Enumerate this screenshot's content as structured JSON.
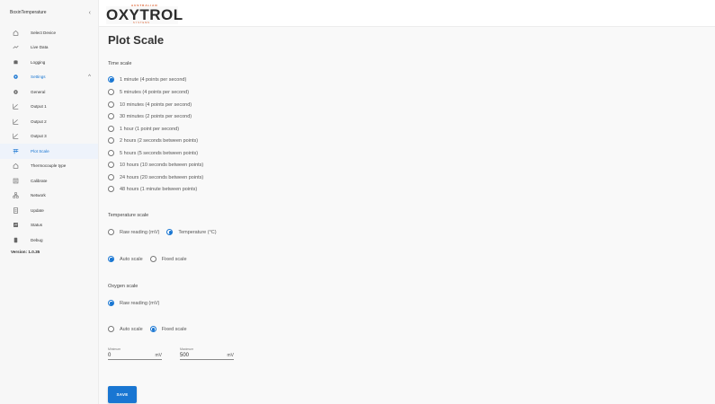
{
  "sidebar": {
    "title": "BoxinTemperature",
    "collapse_icon": "chevron-left-icon",
    "items": [
      {
        "label": "Select Device",
        "icon": "home-icon"
      },
      {
        "label": "Live Data",
        "icon": "trend-icon"
      },
      {
        "label": "Logging",
        "icon": "database-icon"
      },
      {
        "label": "Settings",
        "icon": "gear-icon"
      },
      {
        "label": "General",
        "icon": "gear-icon"
      },
      {
        "label": "Output 1",
        "icon": "chart-line-icon"
      },
      {
        "label": "Output 2",
        "icon": "chart-line-icon"
      },
      {
        "label": "Output 3",
        "icon": "chart-line-icon"
      },
      {
        "label": "Plot Scale",
        "icon": "plot-scale-icon"
      },
      {
        "label": "Thermocouple type",
        "icon": "home-icon"
      },
      {
        "label": "Calibrate",
        "icon": "calibrate-icon"
      },
      {
        "label": "Network",
        "icon": "network-icon"
      },
      {
        "label": "Update",
        "icon": "update-icon"
      },
      {
        "label": "Status",
        "icon": "status-icon"
      },
      {
        "label": "Debug",
        "icon": "debug-icon"
      }
    ],
    "version": "Version: 1.0.35"
  },
  "brand": {
    "top": "AUSTRALIAN",
    "name": "OXYTROL",
    "bottom": "SYSTEMS",
    "accent": "#d9531e"
  },
  "page": {
    "title": "Plot Scale"
  },
  "time_scale": {
    "label": "Time scale",
    "selected": 0,
    "options": [
      "1 minute (4 points per second)",
      "5 minutes (4 points per second)",
      "10 minutes (4 points per second)",
      "30 minutes (2 points per second)",
      "1 hour (1 point per second)",
      "2 hours (2 seconds between points)",
      "5 hours (5 seconds between points)",
      "10 hours (10 seconds between points)",
      "24 hours (20 seconds between points)",
      "48 hours (1 minute between points)"
    ]
  },
  "temperature_scale": {
    "label": "Temperature scale",
    "mode_options": [
      "Raw reading (mV)",
      "Temperature (°C)"
    ],
    "mode_selected": 1,
    "range_options": [
      "Auto scale",
      "Fixed scale"
    ],
    "range_selected": 0
  },
  "oxygen_scale": {
    "label": "Oxygen scale",
    "mode_options": [
      "Raw reading (mV)"
    ],
    "mode_selected": 0,
    "range_options": [
      "Auto scale",
      "Fixed scale"
    ],
    "range_selected": 1,
    "minimum": {
      "label": "Minimum",
      "value": "0",
      "unit": "mV"
    },
    "maximum": {
      "label": "Maximum",
      "value": "500",
      "unit": "mV"
    }
  },
  "actions": {
    "save_label": "SAVE"
  },
  "colors": {
    "primary": "#1976d2"
  }
}
